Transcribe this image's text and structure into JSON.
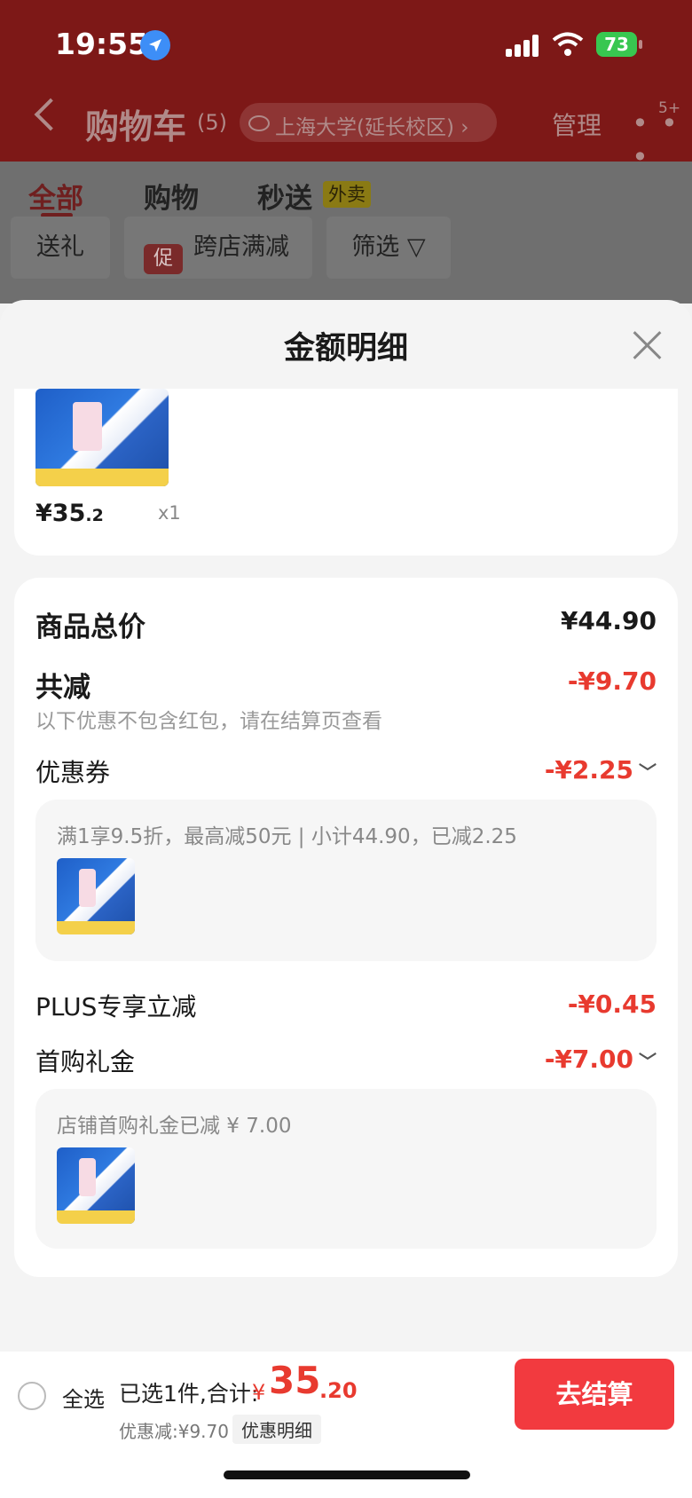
{
  "status_bar": {
    "time": "19:55",
    "battery": "73"
  },
  "header": {
    "title": "购物车",
    "count": "(5)",
    "location": "上海大学(延长校区) ›",
    "manage": "管理",
    "more": "• • •",
    "badge": "5+"
  },
  "tabs": [
    {
      "label": "全部"
    },
    {
      "label": "购物"
    },
    {
      "label": "秒送"
    }
  ],
  "tab_tag": "外卖",
  "filters": {
    "gift": "送礼",
    "promo_tag": "促",
    "cross_store": "跨店满减",
    "filter": "筛选 ▽"
  },
  "sheet": {
    "title": "金额明细",
    "item": {
      "price_int": "¥35",
      "price_dec": ".2",
      "qty": "x1"
    },
    "summary": {
      "total_label": "商品总价",
      "total_value": "¥44.90",
      "reduce_label": "共减",
      "reduce_value": "-¥9.70",
      "note": "以下优惠不包含红包，请在结算页查看",
      "coupon_label": "优惠券",
      "coupon_value": "-¥2.25",
      "coupon_detail": "满1享9.5折，最高减50元 | 小计44.90，已减2.25",
      "plus_label": "PLUS专享立减",
      "plus_value": "-¥0.45",
      "first_label": "首购礼金",
      "first_value": "-¥7.00",
      "first_detail": "店铺首购礼金已减 ¥ 7.00"
    }
  },
  "bottom": {
    "select_all": "全选",
    "summary_label": "已选1件,合计:",
    "currency": "¥",
    "total_int": "35",
    "total_dec": ".20",
    "discount": "优惠减:¥9.70",
    "detail_link": "优惠明细",
    "checkout": "去结算"
  },
  "colors": {
    "accent_red": "#e83a2f",
    "button_red": "#f23a3f",
    "header_red": "#7d1817"
  }
}
